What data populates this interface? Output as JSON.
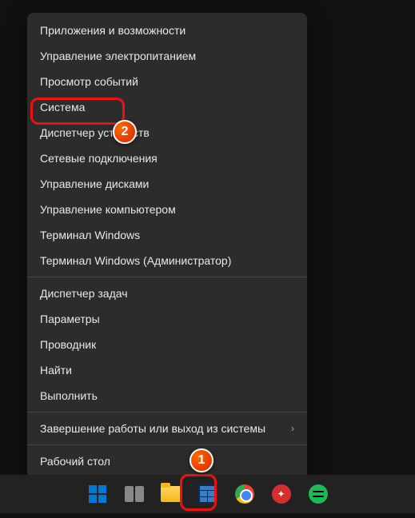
{
  "menu": {
    "group1": [
      "Приложения и возможности",
      "Управление электропитанием",
      "Просмотр событий",
      "Система",
      "Диспетчер устройств",
      "Сетевые подключения",
      "Управление дисками",
      "Управление компьютером",
      "Терминал Windows",
      "Терминал Windows (Администратор)"
    ],
    "group2": [
      "Диспетчер задач",
      "Параметры",
      "Проводник",
      "Найти",
      "Выполнить"
    ],
    "group3": [
      "Завершение работы или выход из системы"
    ],
    "group4": [
      "Рабочий стол"
    ]
  },
  "badges": {
    "b1": "1",
    "b2": "2"
  }
}
